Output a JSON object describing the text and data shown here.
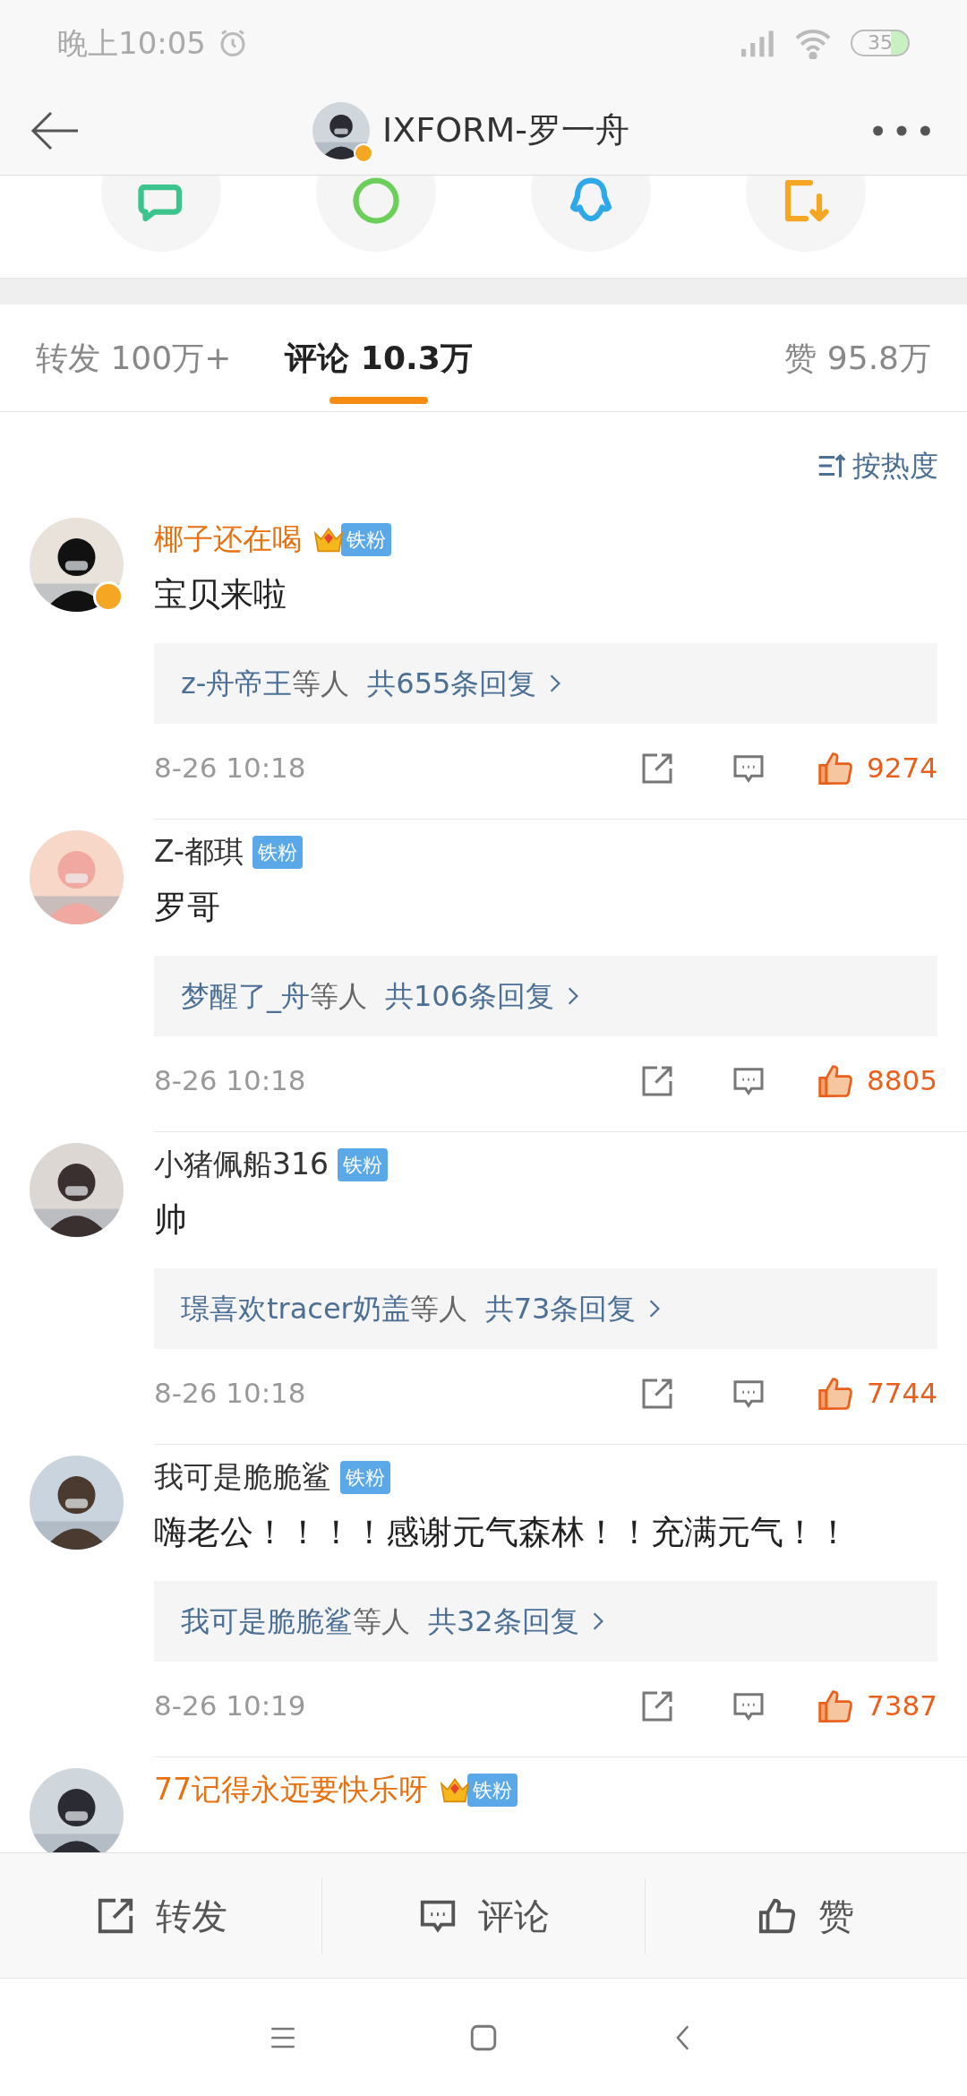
{
  "status_bar": {
    "time": "晚上10:05",
    "battery": "35"
  },
  "header": {
    "title": "IXFORM-罗一舟",
    "verified": true
  },
  "tabs": [
    {
      "label": "转发 100万+",
      "selected": false
    },
    {
      "label": "评论 10.3万",
      "selected": true
    },
    {
      "label": "赞 95.8万",
      "selected": false
    }
  ],
  "sort": {
    "label": "按热度"
  },
  "comments": [
    {
      "name": "椰子还在喝",
      "vip": true,
      "verified": true,
      "badge": "铁粉",
      "text": "宝贝来啦",
      "replies": {
        "who": "z-舟帝王",
        "suffix": "等人",
        "count": "共655条回复"
      },
      "time": "8-26 10:18",
      "likes": "9274"
    },
    {
      "name": "Z-都琪",
      "vip": false,
      "verified": false,
      "badge": "铁粉",
      "text": "罗哥",
      "replies": {
        "who": "梦醒了_舟",
        "suffix": "等人",
        "count": "共106条回复"
      },
      "time": "8-26 10:18",
      "likes": "8805"
    },
    {
      "name": "小猪佩船316",
      "vip": false,
      "verified": false,
      "badge": "铁粉",
      "text": "帅",
      "replies": {
        "who": "璟喜欢tracer奶盖",
        "suffix": "等人",
        "count": "共73条回复"
      },
      "time": "8-26 10:18",
      "likes": "7744"
    },
    {
      "name": "我可是脆脆鲨",
      "vip": false,
      "verified": false,
      "badge": "铁粉",
      "text": "嗨老公！！！！感谢元气森林！！充满元气！！",
      "replies": {
        "who": "我可是脆脆鲨",
        "suffix": "等人",
        "count": "共32条回复"
      },
      "time": "8-26 10:19",
      "likes": "7387"
    },
    {
      "name": "77记得永远要快乐呀",
      "vip": true,
      "verified": false,
      "badge": "铁粉"
    }
  ],
  "actions": [
    "转发",
    "评论",
    "赞"
  ]
}
